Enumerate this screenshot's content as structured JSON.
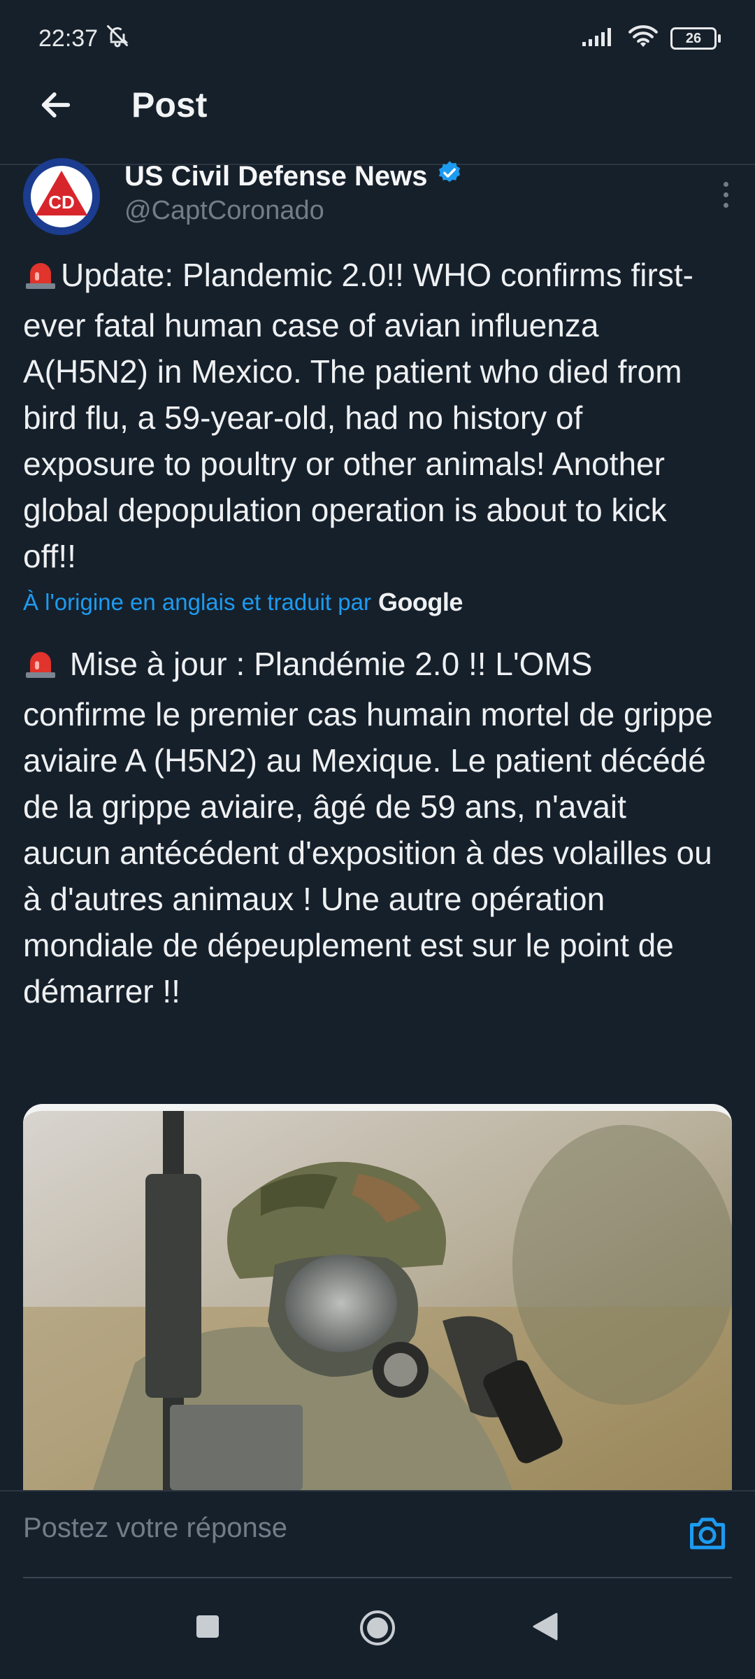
{
  "status_bar": {
    "time": "22:37",
    "battery": "26"
  },
  "header": {
    "title": "Post"
  },
  "author": {
    "name": "US Civil Defense News",
    "handle": "@CaptCoronado",
    "avatar_letters": "CD"
  },
  "post": {
    "text": "Update: Plandemic 2.0!! WHO confirms first-ever fatal human case of avian influenza A(H5N2) in Mexico. The patient who died from bird flu, a 59-year-old, had no history of exposure to poultry or other animals! Another global depopulation operation is about to kick off!!",
    "translation_note": "À l'origine en anglais et traduit par",
    "translation_provider": "Google",
    "translated_text": "Mise à jour : Plandémie 2.0 !! L'OMS confirme le premier cas humain mortel de grippe aviaire A (H5N2) au Mexique. Le patient décédé de la grippe aviaire, âgé de 59 ans, n'avait aucun antécédent d'exposition à des volailles ou à d'autres animaux ! Une autre opération mondiale de dépeuplement est sur le point de démarrer !!"
  },
  "reply": {
    "placeholder": "Postez votre réponse"
  },
  "colors": {
    "background": "#16202b",
    "accent": "#1d9bf0",
    "muted": "#737d88",
    "verified": "#1d9bf0"
  },
  "icons": {
    "back": "arrow-left-icon",
    "verified": "verified-badge-icon",
    "more": "more-vertical-icon",
    "siren": "siren-emoji-icon",
    "camera": "camera-icon",
    "nav_recents": "square-icon",
    "nav_home": "circle-icon",
    "nav_back": "triangle-back-icon"
  }
}
